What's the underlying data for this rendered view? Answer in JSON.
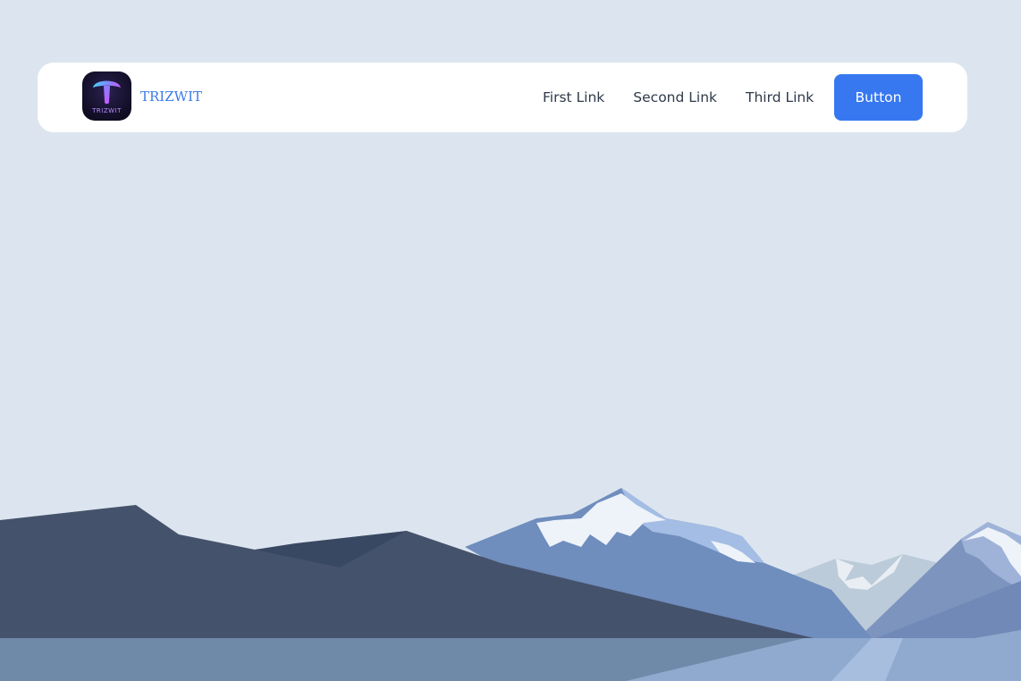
{
  "header": {
    "logo_text": "TRIZWIT",
    "brand_name": "TRIZWIT",
    "links": [
      {
        "label": "First Link"
      },
      {
        "label": "Second Link"
      },
      {
        "label": "Third Link"
      }
    ],
    "button_label": "Button"
  },
  "colors": {
    "background": "#dce5ef",
    "accent": "#3778f0",
    "brand_text": "#3b7be8",
    "mountain_dark": "#45526b",
    "mountain_blue": "#6f8dbd",
    "water": "#6f89a8"
  }
}
